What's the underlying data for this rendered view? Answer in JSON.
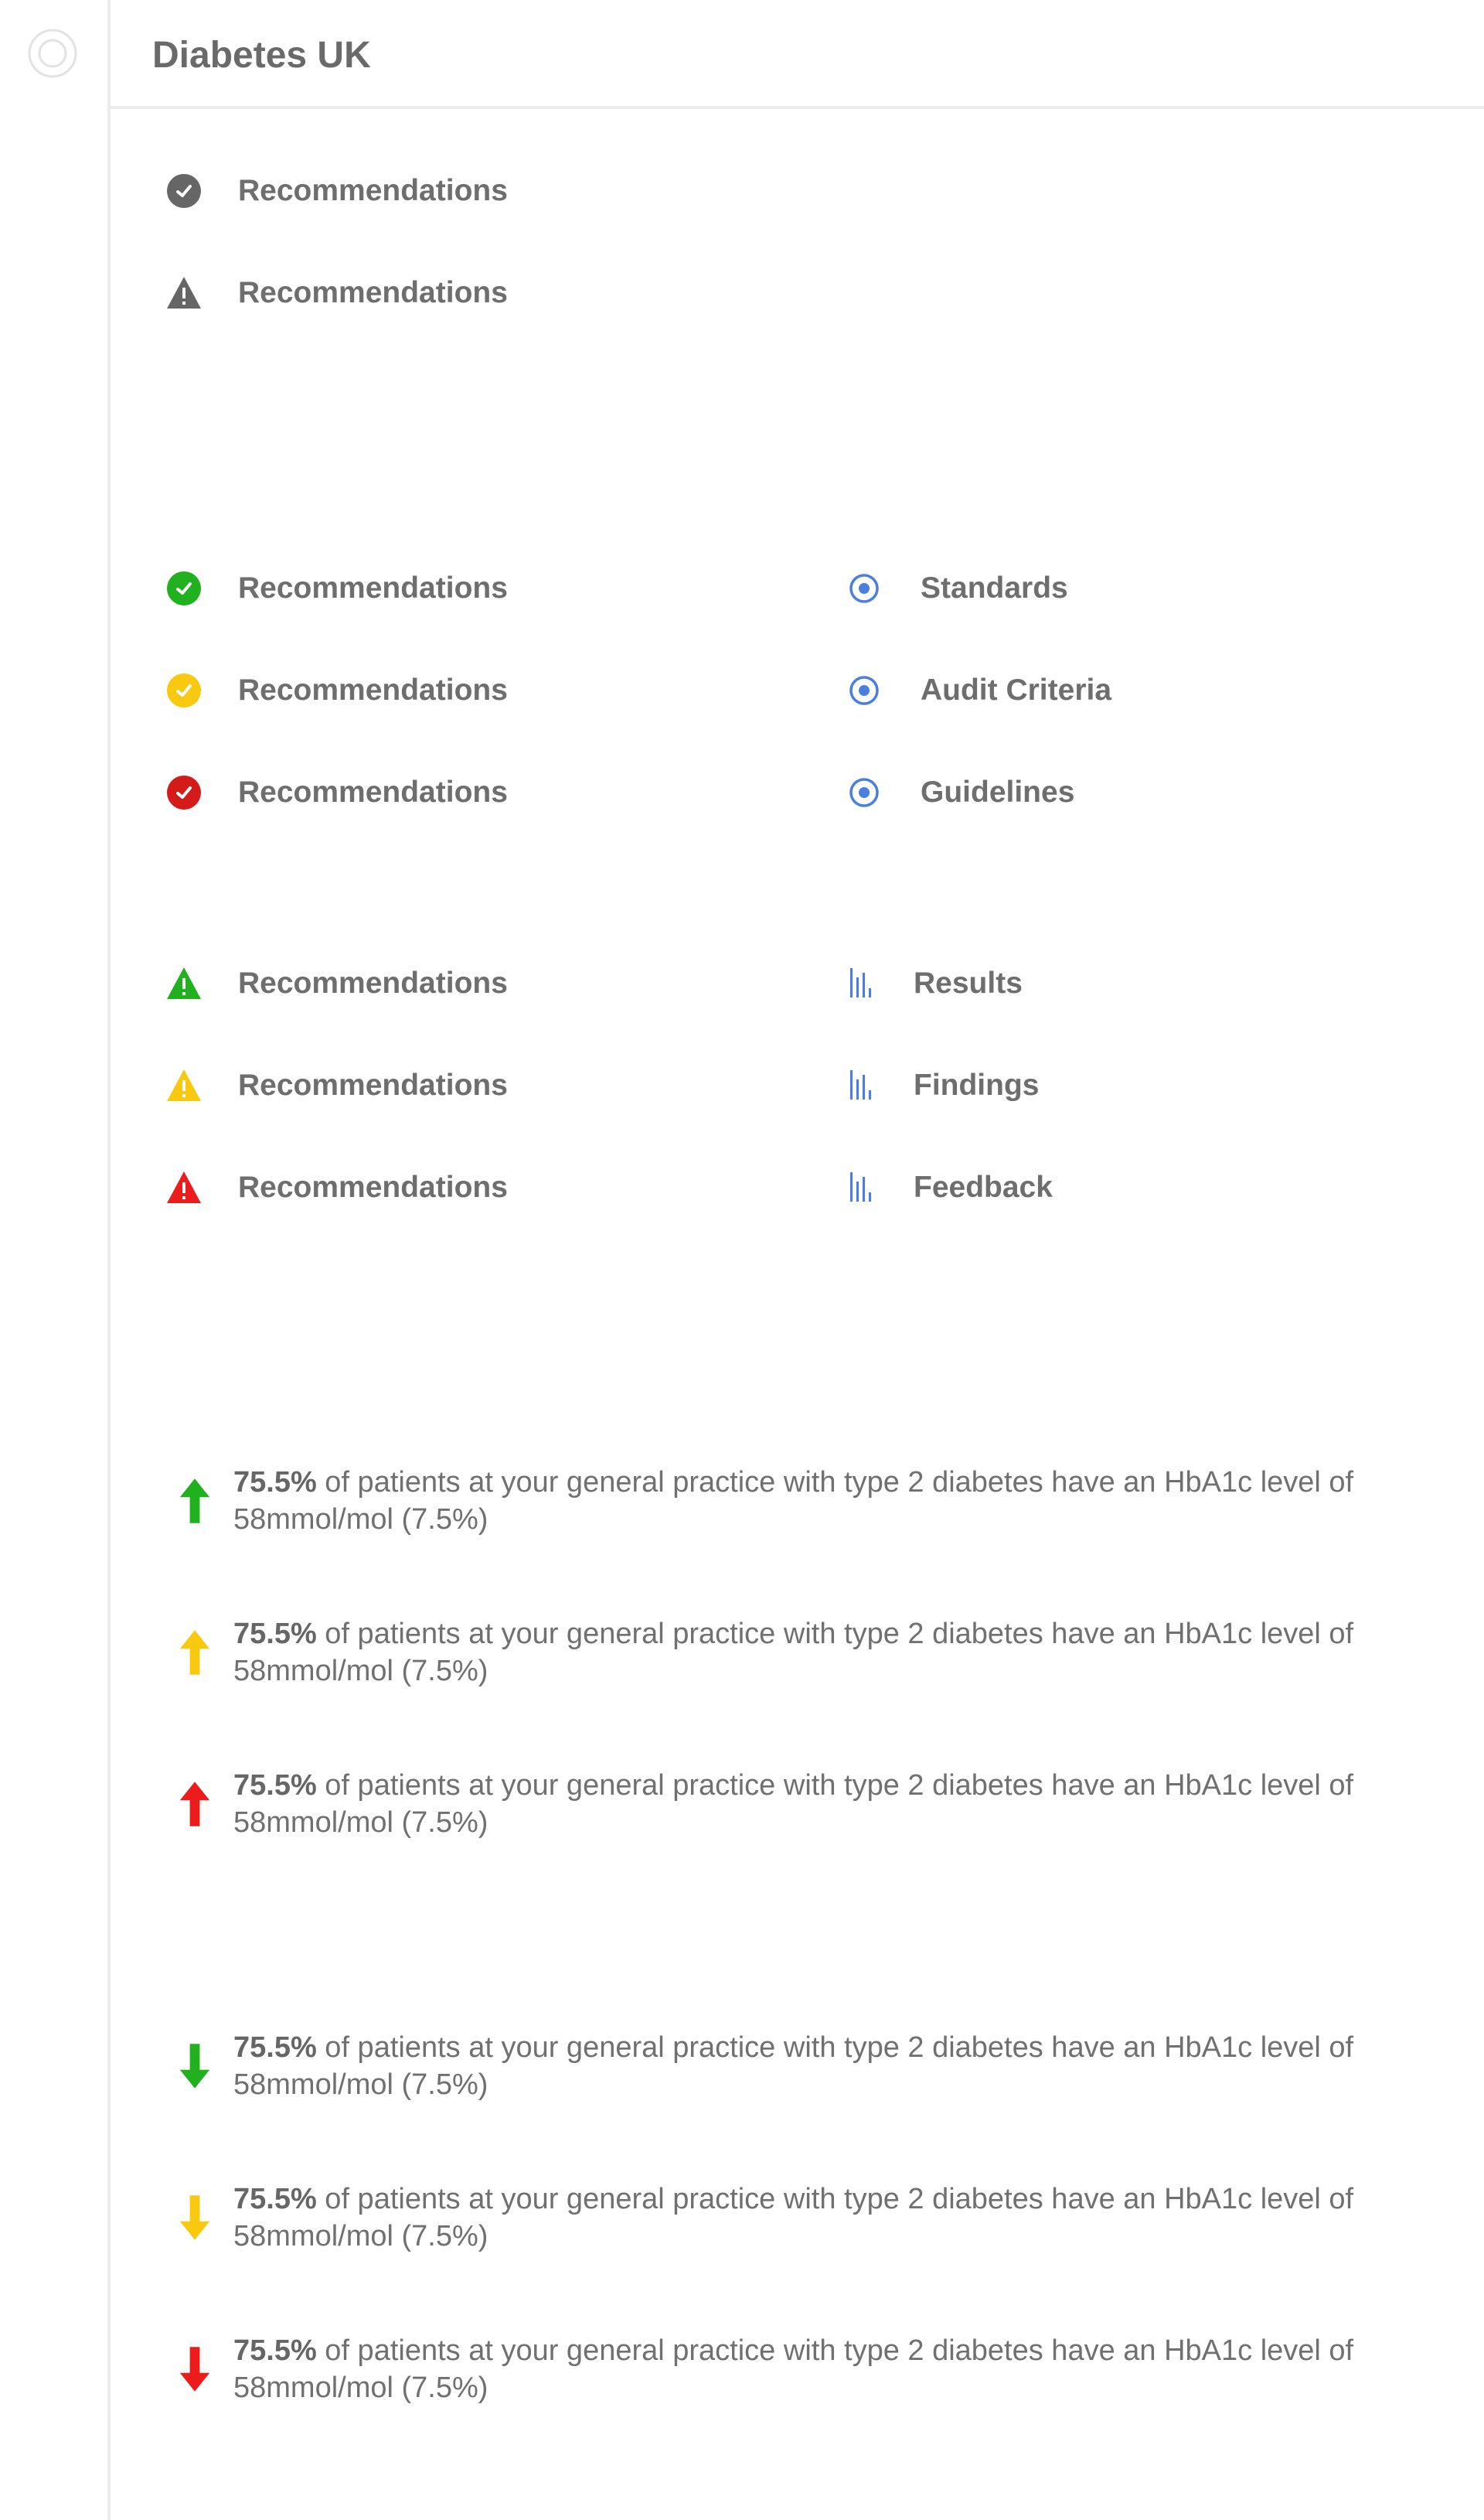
{
  "header": {
    "title": "Diabetes UK"
  },
  "rec_gray": [
    {
      "icon": "check-circle-icon",
      "color": "#666666",
      "label": "Recommendations"
    },
    {
      "icon": "warning-triangle-icon",
      "color": "#666666",
      "label": "Recommendations"
    }
  ],
  "rec_check": [
    {
      "icon": "check-circle-icon",
      "color": "#21b11f",
      "label": "Recommendations"
    },
    {
      "icon": "check-circle-icon",
      "color": "#f9c910",
      "label": "Recommendations"
    },
    {
      "icon": "check-circle-icon",
      "color": "#d51a1a",
      "label": "Recommendations"
    }
  ],
  "links": [
    {
      "icon": "target-icon",
      "color": "#4a7fe0",
      "label": "Standards"
    },
    {
      "icon": "target-icon",
      "color": "#4a7fe0",
      "label": "Audit Criteria"
    },
    {
      "icon": "target-icon",
      "color": "#4a7fe0",
      "label": "Guidelines"
    }
  ],
  "rec_warn": [
    {
      "icon": "warning-triangle-icon",
      "color": "#21b11f",
      "label": "Recommendations"
    },
    {
      "icon": "warning-triangle-icon",
      "color": "#f9c910",
      "label": "Recommendations"
    },
    {
      "icon": "warning-triangle-icon",
      "color": "#ec1c1c",
      "label": "Recommendations"
    }
  ],
  "reports": [
    {
      "icon": "bar-chart-icon",
      "color": "#4a7fe0",
      "label": "Results"
    },
    {
      "icon": "bar-chart-icon",
      "color": "#4a7fe0",
      "label": "Findings"
    },
    {
      "icon": "bar-chart-icon",
      "color": "#4a7fe0",
      "label": "Feedback"
    }
  ],
  "stats_up": [
    {
      "icon": "arrow-up-icon",
      "color": "#21b11f",
      "value": "75.5%",
      "text": " of patients at your general practice with type 2 diabetes have an HbA1c level of 58mmol/mol (7.5%)"
    },
    {
      "icon": "arrow-up-icon",
      "color": "#f9c910",
      "value": "75.5%",
      "text": " of patients at your general practice with type 2 diabetes have an HbA1c level of 58mmol/mol (7.5%)"
    },
    {
      "icon": "arrow-up-icon",
      "color": "#ec1c1c",
      "value": "75.5%",
      "text": " of patients at your general practice with type 2 diabetes have an HbA1c level of 58mmol/mol (7.5%)"
    }
  ],
  "stats_down": [
    {
      "icon": "arrow-down-icon",
      "color": "#21b11f",
      "value": "75.5%",
      "text": " of patients at your general practice with type 2 diabetes have an HbA1c level of 58mmol/mol (7.5%)"
    },
    {
      "icon": "arrow-down-icon",
      "color": "#f9c910",
      "value": "75.5%",
      "text": " of patients at your general practice with type 2 diabetes have an HbA1c level of 58mmol/mol (7.5%)"
    },
    {
      "icon": "arrow-down-icon",
      "color": "#ec1c1c",
      "value": "75.5%",
      "text": " of patients at your general practice with type 2 diabetes have an HbA1c level of 58mmol/mol (7.5%)"
    }
  ]
}
